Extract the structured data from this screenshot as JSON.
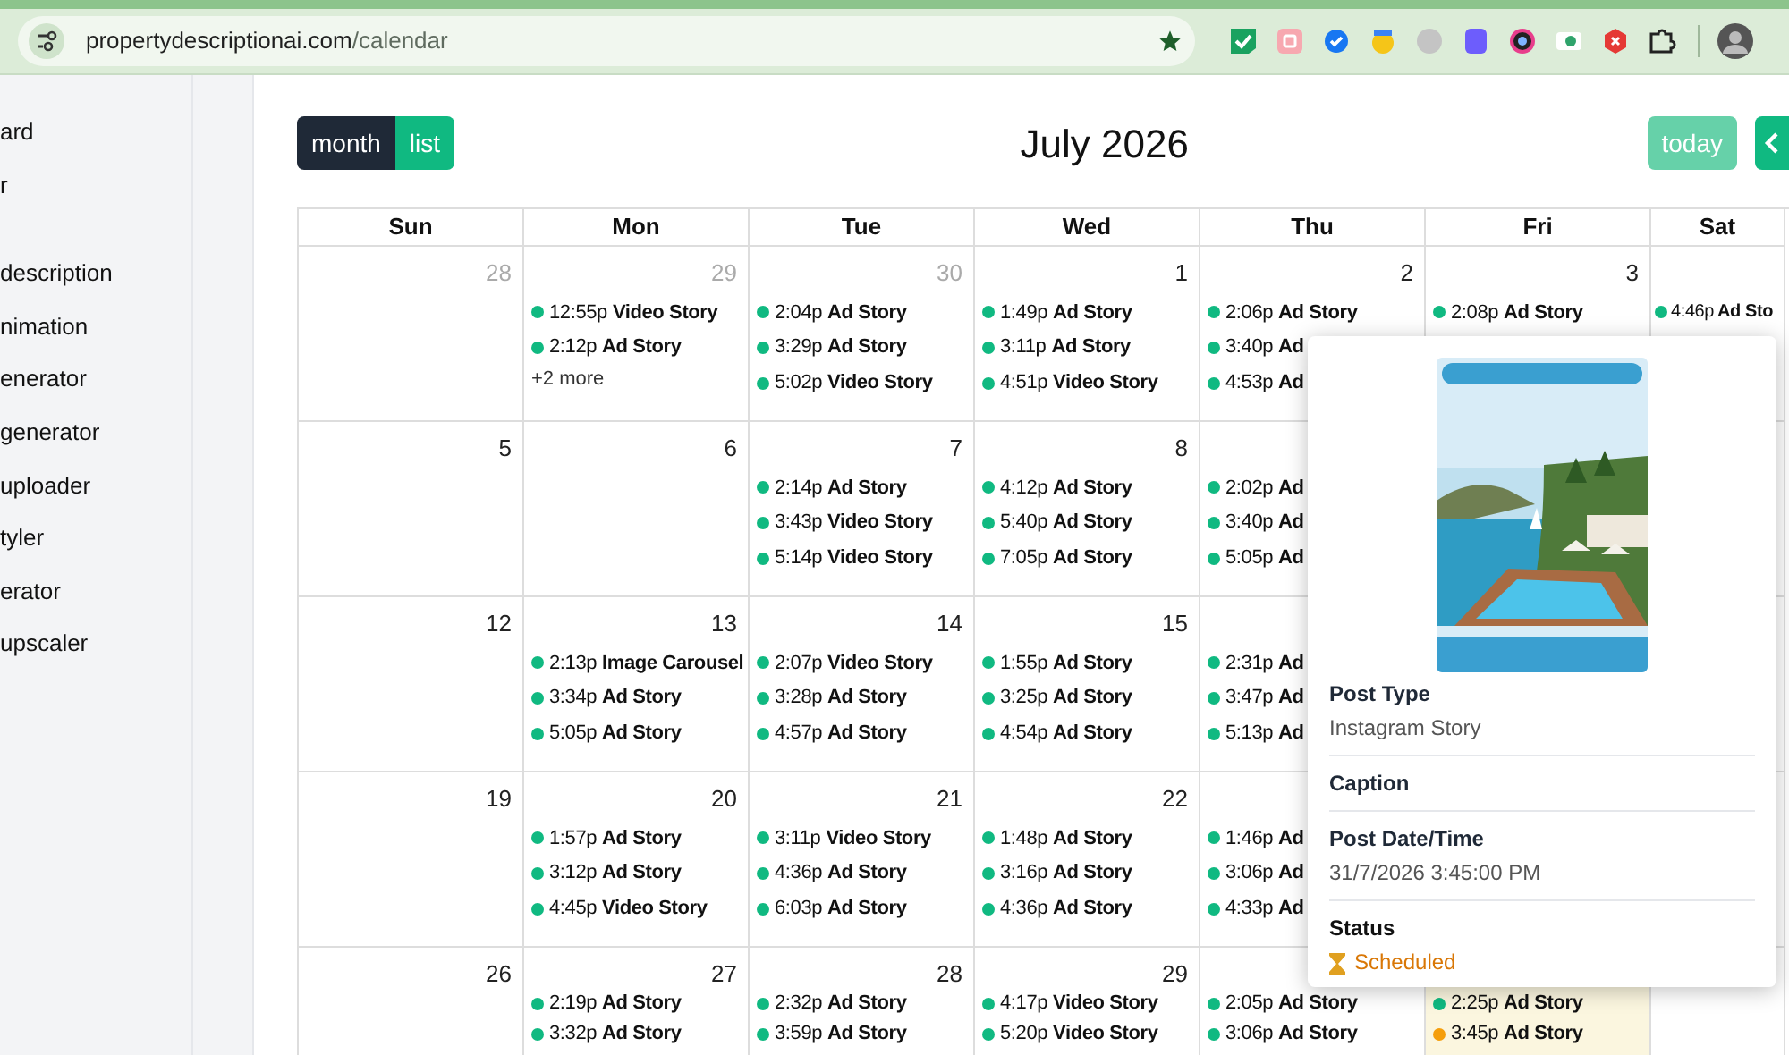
{
  "browser": {
    "url_host": "propertydescriptionai.com",
    "url_path": "/calendar"
  },
  "sidebar": {
    "items": [
      "ard",
      "r",
      "description",
      "nimation",
      "enerator",
      "generator",
      "uploader",
      "tyler",
      "erator",
      "upscaler"
    ]
  },
  "toolbar": {
    "views": [
      {
        "label": "month",
        "selected": true
      },
      {
        "label": "list",
        "selected": false
      }
    ],
    "title": "July 2026",
    "today_button": {
      "label": "today",
      "disabled": true
    }
  },
  "calendar": {
    "columns": [
      "Sun",
      "Mon",
      "Tue",
      "Wed",
      "Thu",
      "Fri",
      "Sat"
    ],
    "weeks": [
      {
        "days": [
          {
            "day": "28",
            "other_month": true,
            "today": false
          },
          {
            "day": "29",
            "other_month": true,
            "today": false,
            "events": [
              {
                "time": "12:55p",
                "title": "Video Story",
                "color": "#10b981"
              },
              {
                "time": "2:12p",
                "title": "Ad Story",
                "color": "#10b981"
              }
            ],
            "more": "+2 more"
          },
          {
            "day": "30",
            "other_month": true,
            "today": false,
            "events": [
              {
                "time": "2:04p",
                "title": "Ad Story",
                "color": "#10b981"
              },
              {
                "time": "3:29p",
                "title": "Ad Story",
                "color": "#10b981"
              },
              {
                "time": "5:02p",
                "title": "Video Story",
                "color": "#10b981"
              }
            ]
          },
          {
            "day": "1",
            "other_month": false,
            "today": false,
            "events": [
              {
                "time": "1:49p",
                "title": "Ad Story",
                "color": "#10b981"
              },
              {
                "time": "3:11p",
                "title": "Ad Story",
                "color": "#10b981"
              },
              {
                "time": "4:51p",
                "title": "Video Story",
                "color": "#10b981"
              }
            ]
          },
          {
            "day": "2",
            "other_month": false,
            "today": false,
            "events": [
              {
                "time": "2:06p",
                "title": "Ad Story",
                "color": "#10b981"
              },
              {
                "time": "3:40p",
                "title": "Ad",
                "color": "#10b981"
              },
              {
                "time": "4:53p",
                "title": "Ad",
                "color": "#10b981"
              }
            ]
          },
          {
            "day": "3",
            "other_month": false,
            "today": false,
            "events": [
              {
                "time": "2:08p",
                "title": "Ad Story",
                "color": "#10b981"
              }
            ]
          },
          {
            "today": false,
            "events": [
              {
                "time": "4:46p",
                "title": "Ad Sto",
                "color": "#10b981"
              }
            ]
          }
        ]
      },
      {
        "days": [
          {
            "day": "5",
            "other_month": false,
            "today": false
          },
          {
            "day": "6",
            "other_month": false,
            "today": false
          },
          {
            "day": "7",
            "other_month": false,
            "today": false,
            "events": [
              {
                "time": "2:14p",
                "title": "Ad Story",
                "color": "#10b981"
              },
              {
                "time": "3:43p",
                "title": "Video Story",
                "color": "#10b981"
              },
              {
                "time": "5:14p",
                "title": "Video Story",
                "color": "#10b981"
              }
            ]
          },
          {
            "day": "8",
            "other_month": false,
            "today": false,
            "events": [
              {
                "time": "4:12p",
                "title": "Ad Story",
                "color": "#10b981"
              },
              {
                "time": "5:40p",
                "title": "Ad Story",
                "color": "#10b981"
              },
              {
                "time": "7:05p",
                "title": "Ad Story",
                "color": "#10b981"
              }
            ]
          },
          {
            "today": false,
            "events": [
              {
                "time": "2:02p",
                "title": "Ad",
                "color": "#10b981"
              },
              {
                "time": "3:40p",
                "title": "Ad",
                "color": "#10b981"
              },
              {
                "time": "5:05p",
                "title": "Ad",
                "color": "#10b981"
              }
            ]
          }
        ]
      },
      {
        "days": [
          {
            "day": "12",
            "other_month": false,
            "today": false
          },
          {
            "day": "13",
            "other_month": false,
            "today": false,
            "events": [
              {
                "time": "2:13p",
                "title": "Image Carousel",
                "color": "#10b981"
              },
              {
                "time": "3:34p",
                "title": "Ad Story",
                "color": "#10b981"
              },
              {
                "time": "5:05p",
                "title": "Ad Story",
                "color": "#10b981"
              }
            ]
          },
          {
            "day": "14",
            "other_month": false,
            "today": false,
            "events": [
              {
                "time": "2:07p",
                "title": "Video Story",
                "color": "#10b981"
              },
              {
                "time": "3:28p",
                "title": "Ad Story",
                "color": "#10b981"
              },
              {
                "time": "4:57p",
                "title": "Ad Story",
                "color": "#10b981"
              }
            ]
          },
          {
            "day": "15",
            "other_month": false,
            "today": false,
            "events": [
              {
                "time": "1:55p",
                "title": "Ad Story",
                "color": "#10b981"
              },
              {
                "time": "3:25p",
                "title": "Ad Story",
                "color": "#10b981"
              },
              {
                "time": "4:54p",
                "title": "Ad Story",
                "color": "#10b981"
              }
            ]
          },
          {
            "today": false,
            "events": [
              {
                "time": "2:31p",
                "title": "Ad",
                "color": "#10b981"
              },
              {
                "time": "3:47p",
                "title": "Ad",
                "color": "#10b981"
              },
              {
                "time": "5:13p",
                "title": "Ad",
                "color": "#10b981"
              }
            ]
          }
        ]
      },
      {
        "days": [
          {
            "day": "19",
            "other_month": false,
            "today": false
          },
          {
            "day": "20",
            "other_month": false,
            "today": false,
            "events": [
              {
                "time": "1:57p",
                "title": "Ad Story",
                "color": "#10b981"
              },
              {
                "time": "3:12p",
                "title": "Ad Story",
                "color": "#10b981"
              },
              {
                "time": "4:45p",
                "title": "Video Story",
                "color": "#10b981"
              }
            ]
          },
          {
            "day": "21",
            "other_month": false,
            "today": false,
            "events": [
              {
                "time": "3:11p",
                "title": "Video Story",
                "color": "#10b981"
              },
              {
                "time": "4:36p",
                "title": "Ad Story",
                "color": "#10b981"
              },
              {
                "time": "6:03p",
                "title": "Ad Story",
                "color": "#10b981"
              }
            ]
          },
          {
            "day": "22",
            "other_month": false,
            "today": false,
            "events": [
              {
                "time": "1:48p",
                "title": "Ad Story",
                "color": "#10b981"
              },
              {
                "time": "3:16p",
                "title": "Ad Story",
                "color": "#10b981"
              },
              {
                "time": "4:36p",
                "title": "Ad Story",
                "color": "#10b981"
              }
            ]
          },
          {
            "today": false,
            "events": [
              {
                "time": "1:46p",
                "title": "Ad",
                "color": "#10b981"
              },
              {
                "time": "3:06p",
                "title": "Ad",
                "color": "#10b981"
              },
              {
                "time": "4:33p",
                "title": "Ad",
                "color": "#10b981"
              }
            ]
          }
        ]
      },
      {
        "days": [
          {
            "day": "26",
            "other_month": false,
            "today": false
          },
          {
            "day": "27",
            "other_month": false,
            "today": false,
            "events": [
              {
                "time": "2:19p",
                "title": "Ad Story",
                "color": "#10b981"
              },
              {
                "time": "3:32p",
                "title": "Ad Story",
                "color": "#10b981"
              }
            ]
          },
          {
            "day": "28",
            "other_month": false,
            "today": false,
            "events": [
              {
                "time": "2:32p",
                "title": "Ad Story",
                "color": "#10b981"
              },
              {
                "time": "3:59p",
                "title": "Ad Story",
                "color": "#10b981"
              }
            ]
          },
          {
            "day": "29",
            "other_month": false,
            "today": false,
            "events": [
              {
                "time": "4:17p",
                "title": "Video Story",
                "color": "#10b981"
              },
              {
                "time": "5:20p",
                "title": "Video Story",
                "color": "#10b981"
              }
            ]
          },
          {
            "today": false,
            "events": [
              {
                "time": "2:05p",
                "title": "Ad Story",
                "color": "#10b981"
              },
              {
                "time": "3:06p",
                "title": "Ad Story",
                "color": "#10b981"
              }
            ]
          },
          {
            "today": true,
            "events": [
              {
                "time": "2:25p",
                "title": "Ad Story",
                "color": "#10b981"
              },
              {
                "time": "3:45p",
                "title": "Ad Story",
                "color": "#f59e0b"
              }
            ]
          },
          {
            "today": false
          }
        ]
      }
    ]
  },
  "popover": {
    "fields": [
      {
        "kind": "text",
        "label": "Post Type",
        "value": "Instagram Story"
      },
      {
        "kind": "text",
        "label": "Caption"
      },
      {
        "kind": "text",
        "label": "Post Date/Time",
        "value": "31/7/2026 3:45:00 PM"
      },
      {
        "kind": "status",
        "label": "Status",
        "value": "Scheduled"
      }
    ]
  }
}
